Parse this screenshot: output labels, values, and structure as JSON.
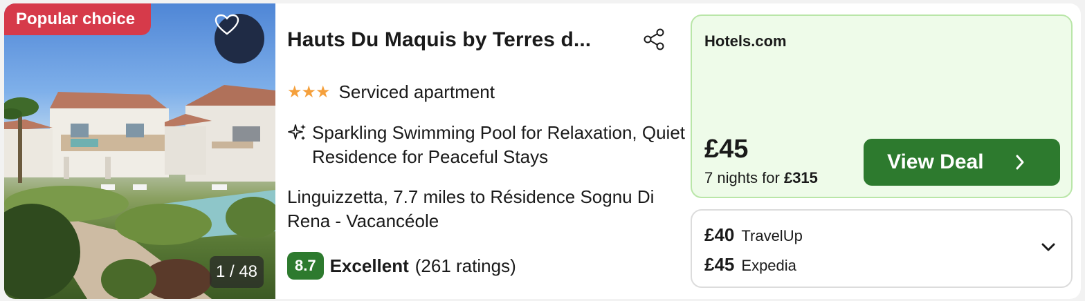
{
  "image": {
    "badge": "Popular choice",
    "counter": "1 / 48",
    "favorite_icon": "heart-icon"
  },
  "hotel": {
    "name": "Hauts Du Maquis by Terres d...",
    "stars": 3,
    "stars_glyphs": "★★★",
    "type": "Serviced apartment",
    "highlight": "Sparkling Swimming Pool for Relaxation, Quiet Residence for Peaceful Stays",
    "location": "Linguizzetta, 7.7 miles to Résidence Sognu Di Rena - Vacancéole",
    "rating": {
      "score": "8.7",
      "label": "Excellent",
      "count": "(261 ratings)"
    }
  },
  "deal": {
    "provider": "Hotels.com",
    "price": "£45",
    "nights_text": "7 nights for ",
    "total": "£315",
    "button_label": "View Deal"
  },
  "other_offers": [
    {
      "price": "£40",
      "provider": "TravelUp"
    },
    {
      "price": "£45",
      "provider": "Expedia"
    }
  ],
  "colors": {
    "badge": "#d63a4a",
    "favorite_button": "#1f2b45",
    "score_badge": "#2d7a2e",
    "deal_background": "#eefbe9",
    "deal_border": "#b9e6a8",
    "cta": "#2d7a2e",
    "stars": "#f5a03c"
  }
}
